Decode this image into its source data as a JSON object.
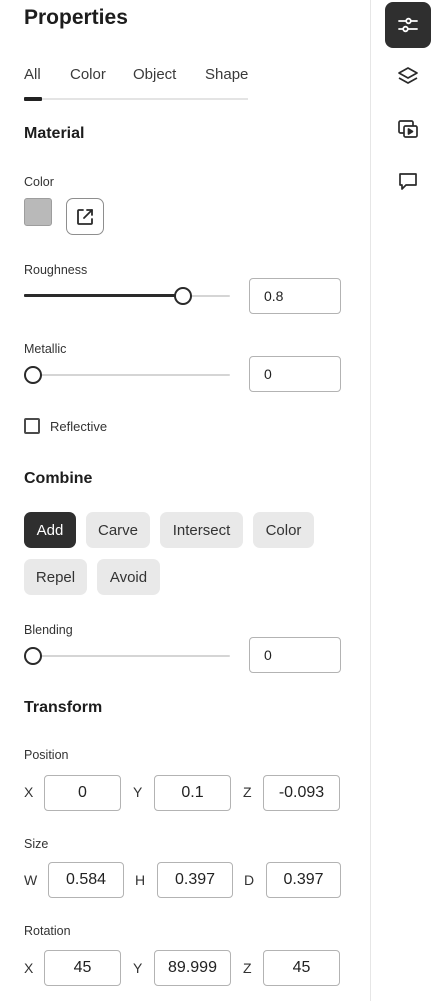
{
  "panel": {
    "title": "Properties",
    "tabs": [
      {
        "label": "All"
      },
      {
        "label": "Color"
      },
      {
        "label": "Object"
      },
      {
        "label": "Shape"
      }
    ],
    "active_tab": "All"
  },
  "material": {
    "title": "Material",
    "color_label": "Color",
    "swatch_color": "#b9b9b9",
    "roughness": {
      "label": "Roughness",
      "value": "0.8",
      "fraction": 0.8
    },
    "metallic": {
      "label": "Metallic",
      "value": "0",
      "fraction": 0
    },
    "reflective": {
      "label": "Reflective",
      "checked": false
    }
  },
  "combine": {
    "title": "Combine",
    "modes": [
      {
        "label": "Add",
        "active": true
      },
      {
        "label": "Carve"
      },
      {
        "label": "Intersect"
      },
      {
        "label": "Color"
      },
      {
        "label": "Repel"
      },
      {
        "label": "Avoid"
      }
    ],
    "blending": {
      "label": "Blending",
      "value": "0",
      "fraction": 0
    }
  },
  "transform": {
    "title": "Transform",
    "position": {
      "label": "Position",
      "axes": [
        "X",
        "Y",
        "Z"
      ],
      "values": [
        "0",
        "0.1",
        "-0.093"
      ]
    },
    "size": {
      "label": "Size",
      "axes": [
        "W",
        "H",
        "D"
      ],
      "values": [
        "0.584",
        "0.397",
        "0.397"
      ]
    },
    "rotation": {
      "label": "Rotation",
      "axes": [
        "X",
        "Y",
        "Z"
      ],
      "values": [
        "45",
        "89.999",
        "45"
      ]
    }
  },
  "rail": {
    "icons": [
      "properties-sliders-icon",
      "layers-icon",
      "media-icon",
      "comment-icon"
    ],
    "active": "properties-sliders-icon"
  },
  "colors": {
    "accent": "#2f2f2f",
    "chip": "#e9e9e9"
  }
}
